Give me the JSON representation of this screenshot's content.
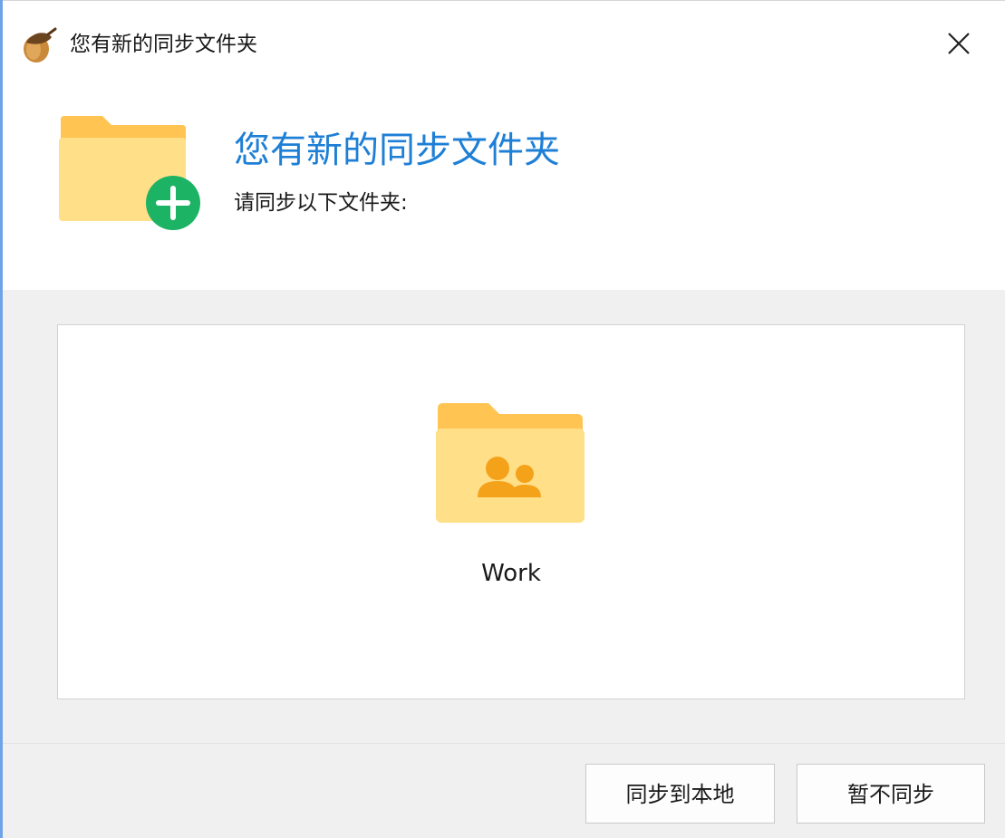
{
  "window": {
    "title": "您有新的同步文件夹",
    "app_icon": "acorn-icon",
    "close_icon": "close-icon"
  },
  "header": {
    "title": "您有新的同步文件夹",
    "subtitle": "请同步以下文件夹:",
    "icon": "folder-add-icon"
  },
  "folders": [
    {
      "name": "Work",
      "icon": "shared-folder-icon"
    }
  ],
  "buttons": {
    "sync_local": "同步到本地",
    "not_now": "暂不同步"
  },
  "colors": {
    "accent_title": "#1e7fd6",
    "folder_back": "#ffc451",
    "folder_front": "#ffdf88",
    "add_badge": "#1db364",
    "people": "#f5a21b",
    "window_border": "#6fa3e8",
    "body_bg": "#f0f0f0"
  }
}
